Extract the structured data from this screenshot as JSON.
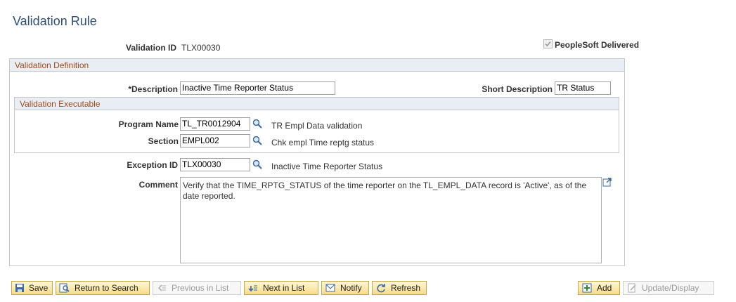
{
  "page": {
    "title": "Validation Rule"
  },
  "header": {
    "validation_id_label": "Validation ID",
    "validation_id_value": "TLX00030",
    "peoplesoft_delivered_label": "PeopleSoft Delivered",
    "peoplesoft_delivered_checked": true
  },
  "definition": {
    "section_title": "Validation Definition",
    "description_label": "*Description",
    "description_value": "Inactive Time Reporter Status",
    "short_description_label": "Short Description",
    "short_description_value": "TR Status"
  },
  "executable": {
    "section_title": "Validation Executable",
    "program_name_label": "Program Name",
    "program_name_value": "TL_TR0012904",
    "program_name_desc": "TR Empl Data validation",
    "section_label": "Section",
    "section_value": "EMPL002",
    "section_desc": "Chk empl Time reptg status"
  },
  "exception": {
    "label": "Exception ID",
    "value": "TLX00030",
    "desc": "Inactive Time Reporter Status"
  },
  "comment": {
    "label": "Comment",
    "value": "Verify that the TIME_RPTG_STATUS of the time reporter on the TL_EMPL_DATA record is 'Active', as of the date reported."
  },
  "toolbar": {
    "save": "Save",
    "return_to_search": "Return to Search",
    "previous_in_list": "Previous in List",
    "next_in_list": "Next in List",
    "notify": "Notify",
    "refresh": "Refresh",
    "add": "Add",
    "update_display": "Update/Display"
  },
  "colors": {
    "title": "#2f4f79",
    "section_header_text": "#a24b17",
    "section_header_bg": "#e9eef4",
    "button_bg": "#f6dc88"
  }
}
